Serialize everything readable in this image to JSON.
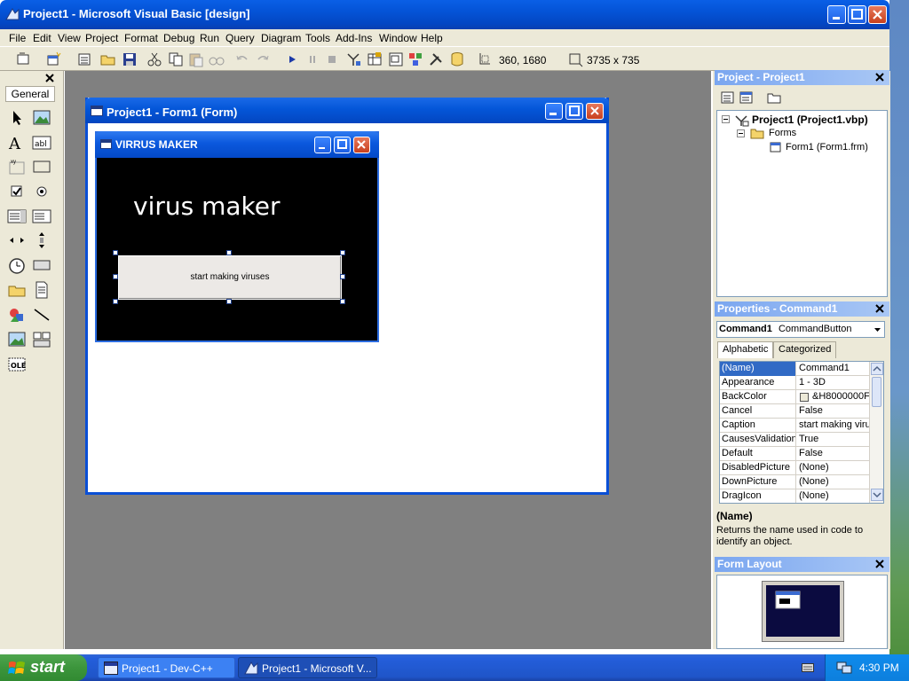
{
  "window": {
    "title": "Project1 - Microsoft Visual Basic [design]"
  },
  "menu": [
    "File",
    "Edit",
    "View",
    "Project",
    "Format",
    "Debug",
    "Run",
    "Query",
    "Diagram",
    "Tools",
    "Add-Ins",
    "Window",
    "Help"
  ],
  "toolbar": {
    "position": "360, 1680",
    "size": "3735 x 735"
  },
  "toolbox": {
    "tab": "General"
  },
  "form_window": {
    "title": "Project1 - Form1 (Form)"
  },
  "designed_form": {
    "caption": "VIRRUS MAKER",
    "label": "virus maker",
    "button_caption": "start making viruses"
  },
  "project_panel": {
    "title": "Project - Project1",
    "project_node": "Project1 (Project1.vbp)",
    "forms_folder": "Forms",
    "form_node": "Form1 (Form1.frm)"
  },
  "properties_panel": {
    "title": "Properties - Command1",
    "object_name": "Command1",
    "object_type": "CommandButton",
    "tabs": [
      "Alphabetic",
      "Categorized"
    ],
    "rows": [
      {
        "name": "(Name)",
        "value": "Command1"
      },
      {
        "name": "Appearance",
        "value": "1 - 3D"
      },
      {
        "name": "BackColor",
        "value": "&H8000000F"
      },
      {
        "name": "Cancel",
        "value": "False"
      },
      {
        "name": "Caption",
        "value": "start making viru"
      },
      {
        "name": "CausesValidation",
        "value": "True"
      },
      {
        "name": "Default",
        "value": "False"
      },
      {
        "name": "DisabledPicture",
        "value": "(None)"
      },
      {
        "name": "DownPicture",
        "value": "(None)"
      },
      {
        "name": "DragIcon",
        "value": "(None)"
      }
    ],
    "description_title": "(Name)",
    "description_text": "Returns the name used in code to identify an object."
  },
  "layout_panel": {
    "title": "Form Layout"
  },
  "taskbar": {
    "start": "start",
    "tasks": [
      "Project1 - Dev-C++",
      "Project1 - Microsoft V..."
    ],
    "clock": "4:30 PM"
  },
  "colors": {
    "xp_blue": "#0453d6",
    "selection": "#316ac5",
    "start_green": "#3c953c"
  }
}
